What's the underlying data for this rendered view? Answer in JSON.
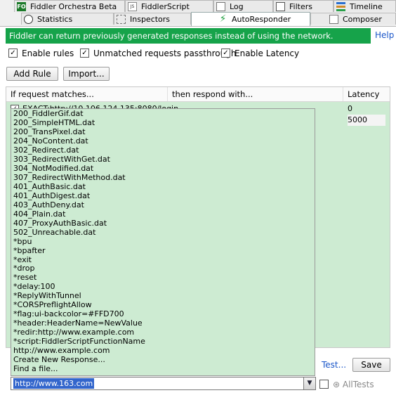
{
  "tabs": {
    "row1": [
      {
        "label": "Fiddler Orchestra Beta",
        "icon": "fo-icon"
      },
      {
        "label": "FiddlerScript",
        "icon": "js-icon"
      },
      {
        "label": "Log",
        "icon": "log-icon"
      },
      {
        "label": "Filters",
        "icon": "filter-icon"
      },
      {
        "label": "Timeline",
        "icon": "timeline-icon"
      }
    ],
    "row2": [
      {
        "label": "Statistics",
        "icon": "stopwatch-icon"
      },
      {
        "label": "Inspectors",
        "icon": "inspector-icon"
      },
      {
        "label": "AutoResponder",
        "icon": "lightning-icon",
        "active": true
      },
      {
        "label": "Composer",
        "icon": "composer-icon"
      }
    ]
  },
  "banner": {
    "text": "Fiddler can return previously generated responses instead of using the network.",
    "help": "Help",
    "color": "#16a34a"
  },
  "options": {
    "enable_rules": "Enable rules",
    "unmatched": "Unmatched requests passthrough",
    "latency": "Enable Latency"
  },
  "buttons": {
    "add_rule": "Add Rule",
    "import": "Import...",
    "test": "Test...",
    "save": "Save"
  },
  "grid": {
    "headers": [
      "If request matches...",
      "then respond with...",
      "Latency"
    ],
    "rows": [
      {
        "match": "EXACT:http://10.106.124.135:8080/login",
        "latency": "0"
      },
      {
        "match": "",
        "latency": "5000"
      }
    ]
  },
  "dropdown_options": [
    "200_FiddlerGif.dat",
    "200_SimpleHTML.dat",
    "200_TransPixel.dat",
    "204_NoContent.dat",
    "302_Redirect.dat",
    "303_RedirectWithGet.dat",
    "304_NotModified.dat",
    "307_RedirectWithMethod.dat",
    "401_AuthBasic.dat",
    "401_AuthDigest.dat",
    "403_AuthDeny.dat",
    "404_Plain.dat",
    "407_ProxyAuthBasic.dat",
    "502_Unreachable.dat",
    "*bpu",
    "*bpafter",
    "*exit",
    "*drop",
    "*reset",
    "*delay:100",
    "*ReplyWithTunnel",
    "*CORSPreflightAllow",
    "*flag:ui-backcolor=#FFD700",
    "*header:HeaderName=NewValue",
    "*redir:http://www.example.com",
    "*script:FiddlerScriptFunctionName",
    "http://www.example.com",
    "Create New Response...",
    "Find a file..."
  ],
  "combo": {
    "value": "http://www.163.com"
  },
  "watermark": "AllTests"
}
